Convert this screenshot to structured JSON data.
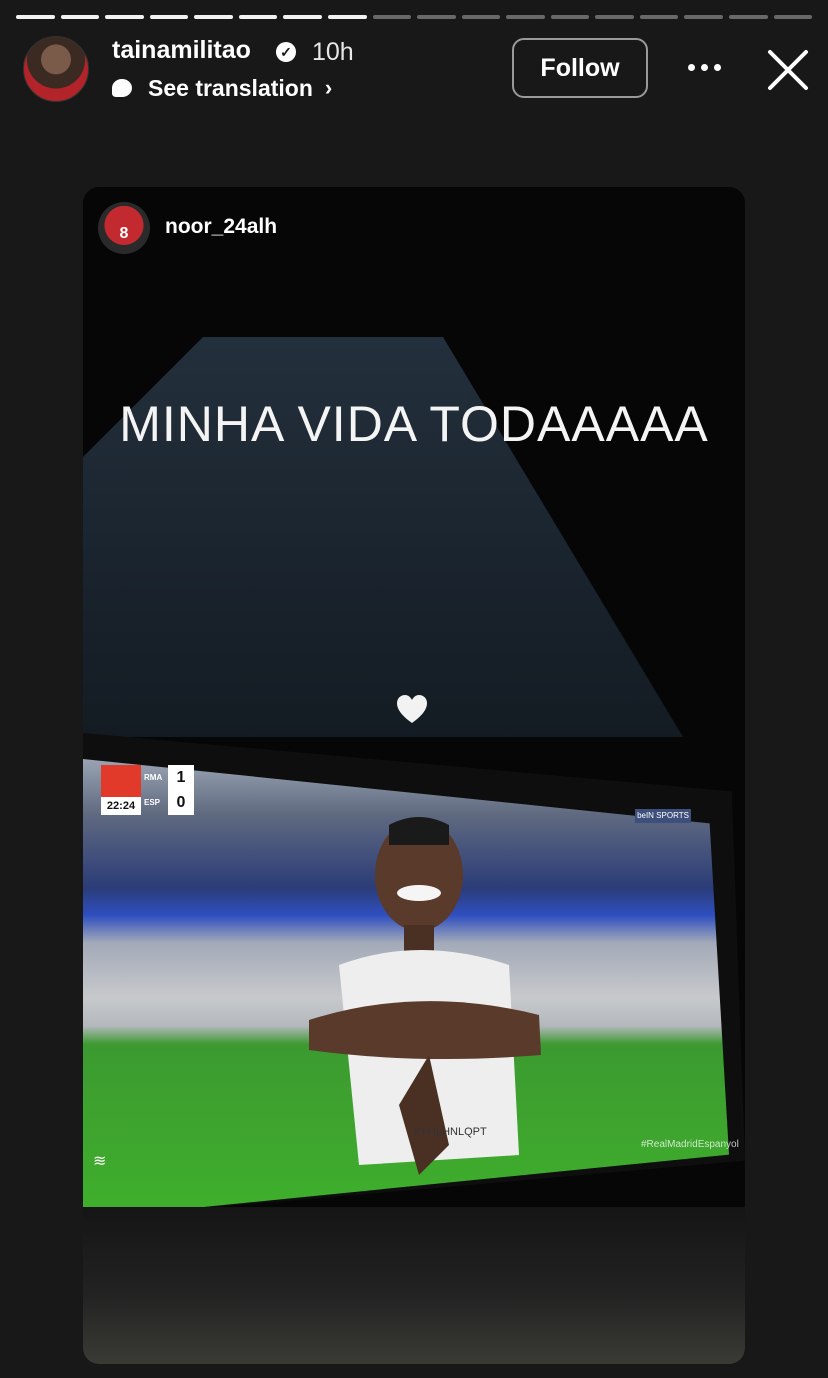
{
  "progress": {
    "segments_total": 18,
    "segments_done": 8
  },
  "header": {
    "username": "tainamilitao",
    "time": "10h",
    "translate_label": "See translation",
    "follow_label": "Follow"
  },
  "story": {
    "username": "noor_24alh",
    "avatar_number": "8",
    "caption": "MINHA VIDA TODAAAAA",
    "scoreboard": {
      "clock": "22:24",
      "home": "RMA",
      "away": "ESP",
      "home_score": "1",
      "away_score": "0"
    },
    "broadcaster": "beIN SPORTS",
    "jersey_text": "KFHLHNLQPT",
    "hashtag": "#RealMadridEspanyol"
  },
  "colors": {
    "background": "#181818",
    "accent": "#ffffff"
  }
}
